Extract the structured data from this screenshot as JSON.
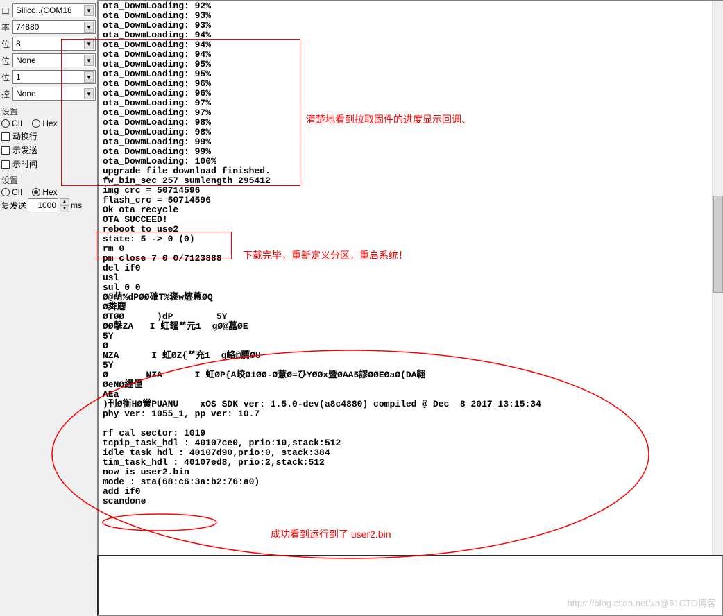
{
  "sidebar": {
    "port_label": "口",
    "port": "Silico..(COM18",
    "baud_label": "率",
    "baud": "74880",
    "data_label": "位",
    "data": "8",
    "parity_label": "位",
    "parity": "None",
    "stop_label": "位",
    "stop": "1",
    "flow_label": "控",
    "flow": "None",
    "recv_section": "设置",
    "ascii": "CII",
    "hex": "Hex",
    "autowrap": "动换行",
    "showsend": "示发送",
    "showtime": "示时间",
    "send_section": "设置",
    "repeat_label": "复发送",
    "repeat_val": "1000",
    "ms": "ms"
  },
  "terminal_lines": [
    "ota_DowmLoading: 92%",
    "ota_DowmLoading: 93%",
    "ota_DowmLoading: 93%",
    "ota_DowmLoading: 94%",
    "ota_DowmLoading: 94%",
    "ota_DowmLoading: 94%",
    "ota_DowmLoading: 95%",
    "ota_DowmLoading: 95%",
    "ota_DowmLoading: 96%",
    "ota_DowmLoading: 96%",
    "ota_DowmLoading: 97%",
    "ota_DowmLoading: 97%",
    "ota_DowmLoading: 98%",
    "ota_DowmLoading: 98%",
    "ota_DowmLoading: 99%",
    "ota_DowmLoading: 99%",
    "ota_DowmLoading: 100%",
    "upgrade file download finished.",
    "fw_bin_sec 257 sumlength 295412",
    "img_crc = 50714596",
    "flash_crc = 50714596",
    "Ok ota recycle",
    "OTA_SUCCEED!",
    "reboot to use2",
    "state: 5 -> 0 (0)",
    "rm 0",
    "pm close 7 0 0/7123888",
    "del if0",
    "usl",
    "sul 0 0",
    "Ø@萌%dPØØ確T%褒w燼蒠ØQ",
    "Ø粦麀",
    "ØTØØ      )dP        5Y",
    "ØØ撀ZA   I 虹鼅ᅓ元1  gØ@藠ØE",
    "5Y",
    "Ø",
    "NZA      I 虹ØZ{ᅓ充1  g峈@薦ØU",
    "5Y",
    "Ø       NZA      I 虹ØP{A峧Ø1ØØ-Ø薏Ø=ひYØØx暨ØAA5謬ØØEØaØ(DA翺",
    "ØeNØ纆偅",
    "AEa",
    ")刊Ø衡HØ黉PUANU    xOS SDK ver: 1.5.0-dev(a8c4880) compiled @ Dec  8 2017 13:15:34",
    "phy ver: 1055_1, pp ver: 10.7",
    "",
    "rf cal sector: 1019",
    "tcpip_task_hdl : 40107ce0, prio:10,stack:512",
    "idle_task_hdl : 40107d90,prio:0, stack:384",
    "tim_task_hdl : 40107ed8, prio:2,stack:512",
    "now is user2.bin",
    "mode : sta(68:c6:3a:b2:76:a0)",
    "add if0",
    "scandone"
  ],
  "annotations": {
    "a1": "清楚地看到拉取固件的进度显示回调、",
    "a2": "下载完毕，重新定义分区，重启系统！",
    "a3": "成功看到运行到了 user2.bin"
  },
  "watermark": "https://blog.csdn.net/xh@51CTO博客"
}
